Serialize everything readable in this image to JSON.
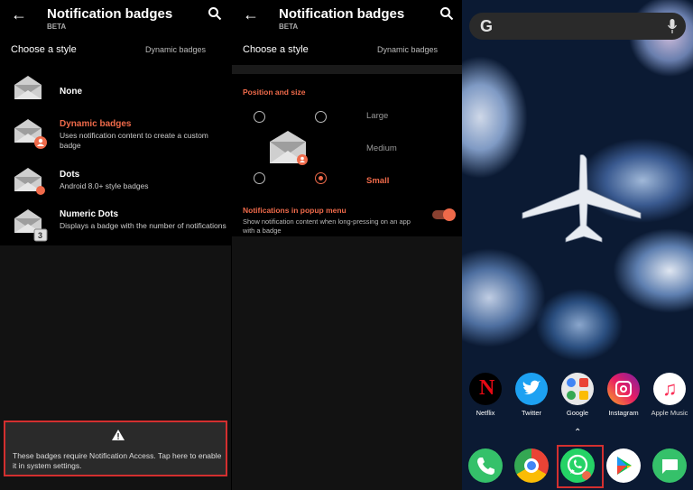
{
  "screen1": {
    "title": "Notification badges",
    "subtitle": "BETA",
    "style_label": "Choose a style",
    "style_value": "Dynamic badges",
    "options": [
      {
        "name": "None",
        "desc": ""
      },
      {
        "name": "Dynamic badges",
        "desc": "Uses notification content to create a custom badge"
      },
      {
        "name": "Dots",
        "desc": "Android 8.0+ style badges"
      },
      {
        "name": "Numeric Dots",
        "desc": "Displays a badge with the number of notifications",
        "badge_number": "3"
      }
    ],
    "banner_text": "These badges require Notification Access. Tap here to enable it in system settings.",
    "warning_icon": "warning-icon"
  },
  "screen2": {
    "title": "Notification badges",
    "subtitle": "BETA",
    "style_label": "Choose a style",
    "style_value": "Dynamic badges",
    "section_title": "Position and size",
    "sizes": [
      "Large",
      "Medium",
      "Small"
    ],
    "selected_size": "Small",
    "popup_title": "Notifications in popup menu",
    "popup_desc": "Show notification content when long-pressing on an app with a badge",
    "popup_enabled": true
  },
  "screen3": {
    "search_logo": "G",
    "apps_row": [
      {
        "label": "Netflix",
        "icon": "netflix-icon"
      },
      {
        "label": "Twitter",
        "icon": "twitter-icon"
      },
      {
        "label": "Google",
        "icon": "google-folder-icon"
      },
      {
        "label": "Instagram",
        "icon": "instagram-icon"
      },
      {
        "label": "Apple Music",
        "icon": "apple-music-icon"
      }
    ],
    "dock": [
      {
        "icon": "phone-icon"
      },
      {
        "icon": "chrome-icon"
      },
      {
        "icon": "whatsapp-icon"
      },
      {
        "icon": "play-store-icon"
      },
      {
        "icon": "messages-icon"
      }
    ]
  },
  "colors": {
    "accent": "#ef6a4a",
    "highlight_box": "#d32f2f",
    "background": "#121212"
  }
}
